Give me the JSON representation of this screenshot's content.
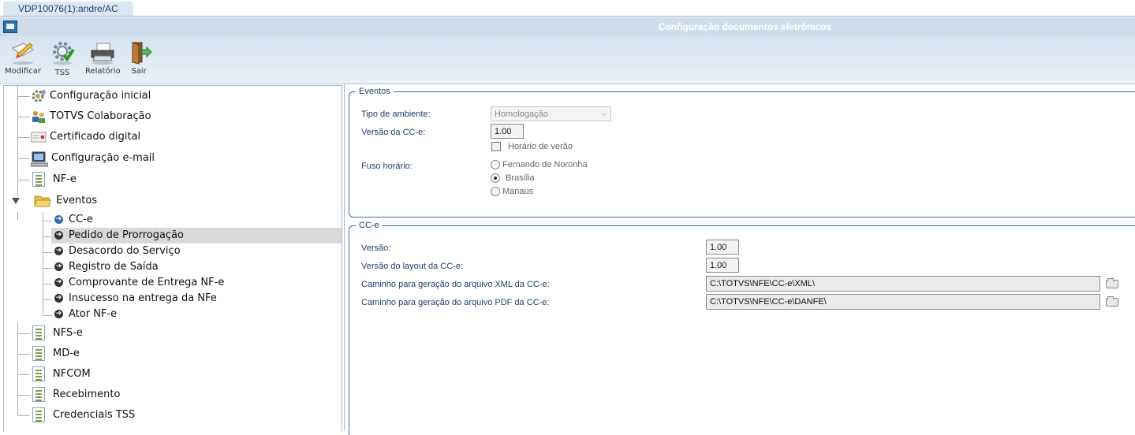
{
  "session": {
    "tab_label": "VDP10076(1):andre/AC"
  },
  "window": {
    "title": "Configuração documentos eletrônicos"
  },
  "toolbar": {
    "buttons": [
      {
        "label": "Modificar",
        "icon": "edit-pencil-icon"
      },
      {
        "label": "TSS",
        "icon": "gear-check-icon"
      },
      {
        "label": "Relatório",
        "icon": "printer-icon"
      },
      {
        "label": "Sair",
        "icon": "exit-door-icon"
      }
    ]
  },
  "tree": {
    "items": [
      {
        "label": "Configuração inicial",
        "icon": "gears-icon"
      },
      {
        "label": "TOTVS Colaboração",
        "icon": "people-icon"
      },
      {
        "label": "Certificado digital",
        "icon": "certificate-icon"
      },
      {
        "label": "Configuração e-mail",
        "icon": "computer-icon"
      },
      {
        "label": "NF-e",
        "icon": "document-list-icon"
      },
      {
        "label": "Eventos",
        "icon": "folder-open-icon"
      },
      {
        "label": "NFS-e",
        "icon": "document-list-icon"
      },
      {
        "label": "MD-e",
        "icon": "document-list-icon"
      },
      {
        "label": "NFCOM",
        "icon": "document-list-icon"
      },
      {
        "label": "Recebimento",
        "icon": "document-list-icon"
      },
      {
        "label": "Credenciais TSS",
        "icon": "document-list-icon"
      }
    ],
    "events_children": [
      {
        "label": "CC-e",
        "selected": true
      },
      {
        "label": "Pedido de Prorrogação"
      },
      {
        "label": "Desacordo do Serviço"
      },
      {
        "label": "Registro de Saída"
      },
      {
        "label": "Comprovante de Entrega NF-e"
      },
      {
        "label": "Insucesso na entrega da NFe"
      },
      {
        "label": "Ator NF-e"
      }
    ]
  },
  "eventos": {
    "legend": "Eventos",
    "tipo_ambiente_label": "Tipo de ambiente:",
    "tipo_ambiente_value": "Homologação",
    "versao_cce_label": "Versão da CC-e:",
    "versao_cce_value": "1.00",
    "horario_verao_label": "Horário de verão",
    "horario_verao_checked": false,
    "fuso_label": "Fuso horário:",
    "fuso_options": [
      "Fernando de Noronha",
      "Brasília",
      "Manaus"
    ],
    "fuso_selected": "Brasília"
  },
  "cce": {
    "legend": "CC-e",
    "versao_label": "Versão:",
    "versao_value": "1.00",
    "versao_layout_label": "Versão do layout da CC-e:",
    "versao_layout_value": "1.00",
    "xml_path_label": "Caminho para geração do arquivo XML da CC-e:",
    "xml_path_value": "C:\\TOTVS\\NFE\\CC-e\\XML\\",
    "pdf_path_label": "Caminho para geração do arquivo PDF da CC-e:",
    "pdf_path_value": "C:\\TOTVS\\NFE\\CC-e\\DANFE\\"
  }
}
